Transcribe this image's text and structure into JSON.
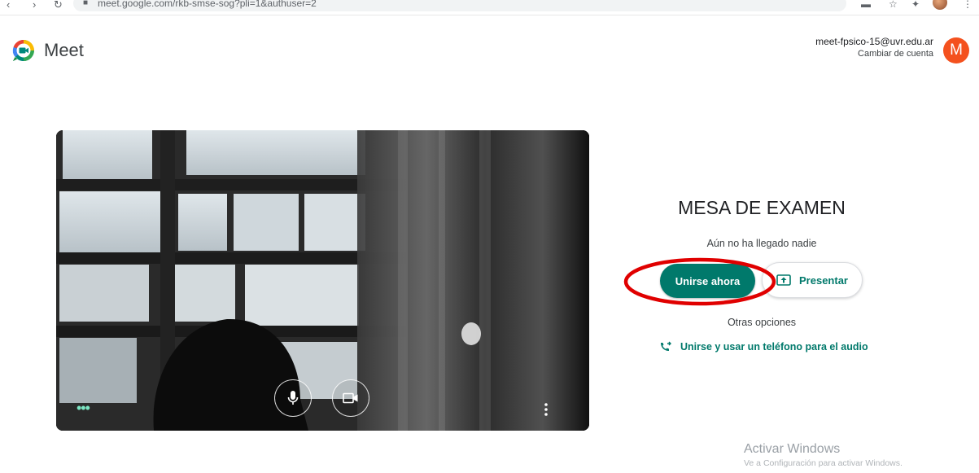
{
  "browser": {
    "url": "meet.google.com/rkb-smse-sog?pli=1&authuser=2"
  },
  "header": {
    "app_name": "Meet",
    "account_email": "meet-fpsico-15@uvr.edu.ar",
    "switch_account": "Cambiar de cuenta",
    "avatar_letter": "M",
    "avatar_color": "#f4511e"
  },
  "preview": {
    "mic_icon": "microphone-icon",
    "camera_icon": "video-camera-icon",
    "more_options_icon": "more-vert-icon",
    "effects_icon": "more-horiz-icon"
  },
  "panel": {
    "meeting_title": "MESA DE EXAMEN",
    "status": "Aún no ha llegado nadie",
    "join_label": "Unirse ahora",
    "present_label": "Presentar",
    "other_options": "Otras opciones",
    "phone_link": "Unirse y usar un teléfono para el audio",
    "accent_color": "#00796b",
    "highlight_color": "#e00000"
  },
  "watermark": {
    "line1": "Activar Windows",
    "line2": "Ve a Configuración para activar Windows."
  }
}
